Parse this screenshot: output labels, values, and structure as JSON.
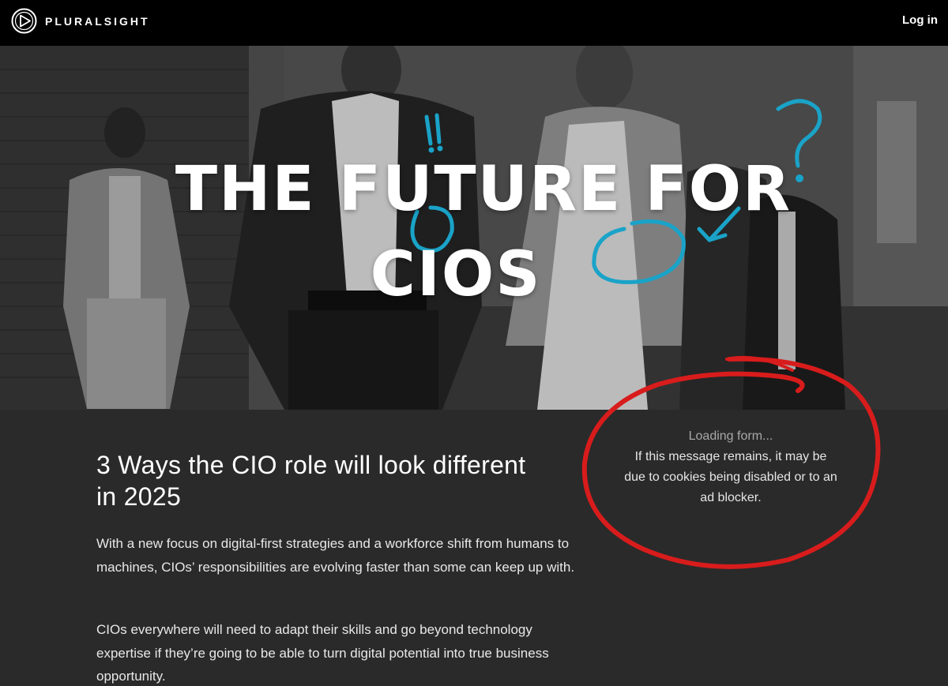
{
  "header": {
    "brand": "PLURALSIGHT",
    "login_label": "Log in"
  },
  "hero": {
    "title_line1": "THE FUTURE FOR",
    "title_line2": "CIOS"
  },
  "main": {
    "headline": "3 Ways the CIO role will look different in 2025",
    "paragraphs": [
      "With a new focus on digital-first strategies and a workforce shift from humans to machines, CIOs’ responsibilities are evolving faster than some can keep up with.",
      "CIOs everywhere will need to adapt their skills and go beyond technology expertise if they’re going to be able to turn digital potential into true business opportunity."
    ]
  },
  "form": {
    "loading_text": "Loading form...",
    "warning_text": "If this message remains, it may be due to cookies being disabled or to an ad blocker."
  },
  "colors": {
    "accent_doodle": "#1aa3c8",
    "annotation_red": "#d81c1c",
    "topbar": "#000000",
    "content_bg": "#2a2a2a"
  }
}
